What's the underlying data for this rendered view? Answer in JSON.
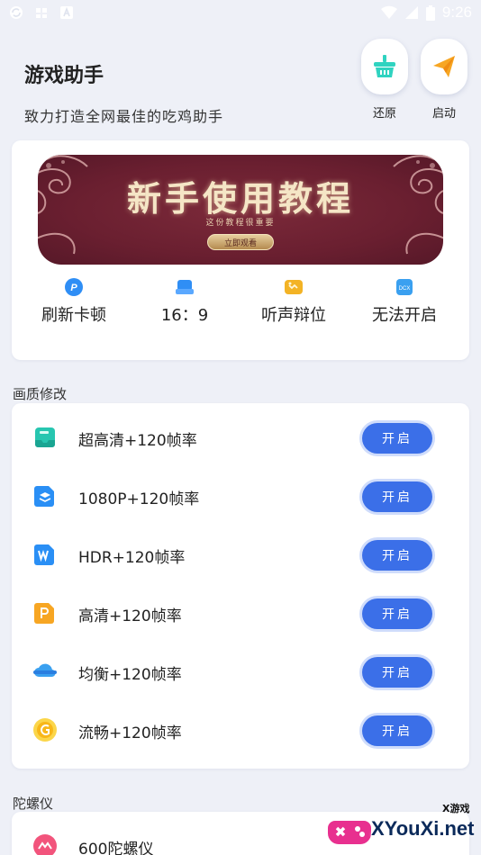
{
  "status_bar": {
    "time": "9:26"
  },
  "header": {
    "title": "游戏助手",
    "subtitle": "致力打造全网最佳的吃鸡助手",
    "restore_label": "还原",
    "launch_label": "启动"
  },
  "banner": {
    "title": "新手使用教程",
    "subtitle": "这份教程很重要",
    "button_label": "立即观看"
  },
  "quick_actions": [
    {
      "label": "刷新卡顿",
      "icon": "p-circle-icon",
      "color": "#2f8ef5"
    },
    {
      "label": "16：9",
      "icon": "ratio-icon",
      "color": "#2f8ef5"
    },
    {
      "label": "听声辩位",
      "icon": "sound-icon",
      "color": "#f3b325"
    },
    {
      "label": "无法开启",
      "icon": "docx-icon",
      "color": "#3aa0f0"
    }
  ],
  "quality_section": {
    "title": "画质修改",
    "items": [
      {
        "label": "超高清+120帧率",
        "icon": "inbox-icon",
        "button": "开启"
      },
      {
        "label": "1080P+120帧率",
        "icon": "layers-icon",
        "button": "开启"
      },
      {
        "label": "HDR+120帧率",
        "icon": "word-icon",
        "button": "开启"
      },
      {
        "label": "高清+120帧率",
        "icon": "ppt-icon",
        "button": "开启"
      },
      {
        "label": "均衡+120帧率",
        "icon": "cloud-icon",
        "button": "开启"
      },
      {
        "label": "流畅+120帧率",
        "icon": "coin-icon",
        "button": "开启"
      }
    ]
  },
  "gyro_section": {
    "title": "陀螺仪",
    "items": [
      {
        "label": "600陀螺仪",
        "icon": "gyro-icon"
      }
    ]
  },
  "watermark": {
    "small": "X游戏",
    "big": "XYouXi.net"
  },
  "colors": {
    "accent": "#3b6fe8",
    "background": "#eef0f7",
    "banner": "#6a1f30"
  }
}
